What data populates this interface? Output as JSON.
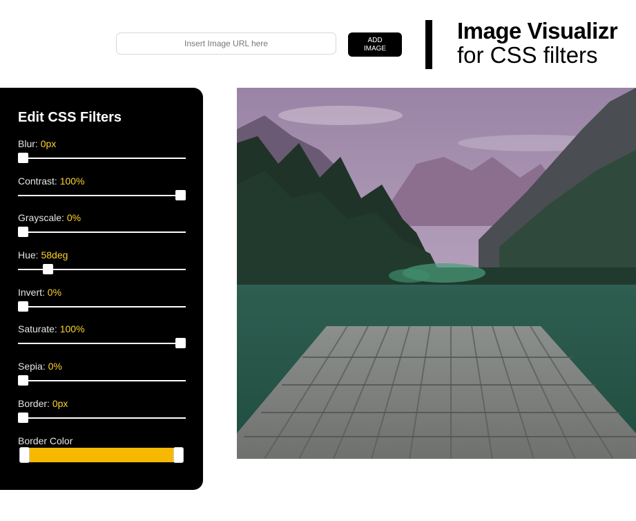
{
  "header": {
    "url_placeholder": "Insert Image URL here",
    "add_button_label": "ADD\nIMAGE",
    "title_main": "Image Visualizr",
    "title_sub": "for CSS filters"
  },
  "sidebar": {
    "title": "Edit CSS Filters",
    "filters": [
      {
        "label": "Blur:",
        "value": "0px",
        "level": 0.0
      },
      {
        "label": "Contrast:",
        "value": "100%",
        "level": 1.0
      },
      {
        "label": "Grayscale:",
        "value": "0%",
        "level": 0.0
      },
      {
        "label": "Hue:",
        "value": "58deg",
        "level": 0.16
      },
      {
        "label": "Invert:",
        "value": "0%",
        "level": 0.0
      },
      {
        "label": "Saturate:",
        "value": "100%",
        "level": 1.0
      },
      {
        "label": "Sepia:",
        "value": "0%",
        "level": 0.0
      },
      {
        "label": "Border:",
        "value": "0px",
        "level": 0.0
      }
    ],
    "border_color_label": "Border Color",
    "border_color": "#f6b800"
  },
  "colors": {
    "accent": "#ffd52b",
    "panel": "#000000"
  },
  "preview": {
    "icon": "lake-dock-photo"
  }
}
